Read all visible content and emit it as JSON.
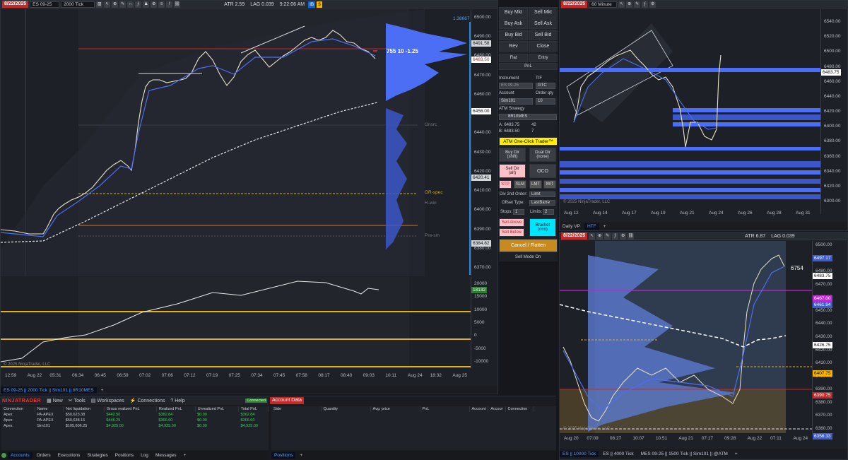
{
  "top_left": {
    "date": "8/22/2025",
    "instrument": "ES 09-25",
    "interval": "2000 Tick",
    "atr": "ATR 2.59",
    "lag": "LAG 0.039",
    "time": "9:22:06 AM",
    "badge1": "IB",
    "badge2": "$",
    "y_ticks": [
      "6500.00",
      "6490.00",
      "6480.00",
      "6470.00",
      "6460.00",
      "6450.00",
      "6440.00",
      "6430.00",
      "6420.00",
      "6410.00",
      "6400.00",
      "6390.00",
      "6380.00",
      "6370.00"
    ],
    "price_tags": [
      {
        "v": "6491.58",
        "bg": "#d3d6db",
        "fg": "#111"
      },
      {
        "v": "6483.50",
        "bg": "#ffffff",
        "fg": "#c62828"
      },
      {
        "v": "6456.00",
        "bg": "#ffffff",
        "fg": "#111"
      },
      {
        "v": "6420.41",
        "bg": "#d3d6db",
        "fg": "#111"
      },
      {
        "v": "6384.82",
        "bg": "#d3d6db",
        "fg": "#111"
      }
    ],
    "top_tag": "1.38667",
    "order_label": "755  10  -1.25",
    "level_labels": [
      "Onsrc",
      "OR-spec",
      "R-win",
      "Pre-sm"
    ],
    "ind_ticks": [
      "20000",
      "15000",
      "10000",
      "5000",
      "0",
      "-5000",
      "-10000"
    ],
    "ind_tag": "18132",
    "x_labels": [
      "12:59",
      "Aug 22",
      "05:31",
      "06:34",
      "06:45",
      "06:59",
      "07:02",
      "07:06",
      "07:12",
      "07:19",
      "07:25",
      "07:34",
      "07:45",
      "07:58",
      "08:17",
      "08:40",
      "09:03",
      "10:11",
      "Aug 24",
      "18:32",
      "Aug 25"
    ],
    "copyright": "© 2025 NinjaTrader, LLC",
    "bottom_tab": "ES 09-25 || 2000 Tick || Sim101 || 8R10MES"
  },
  "dom": {
    "buttons": [
      [
        "Buy Mkt",
        "Sell Mkt"
      ],
      [
        "Buy Ask",
        "Sell Ask"
      ],
      [
        "Buy Bid",
        "Sell Bid"
      ],
      [
        "Rev",
        "Close"
      ],
      [
        "Flat",
        "Entry"
      ]
    ],
    "pnl": "PnL",
    "instrument_label": "Instrument",
    "tif_label": "TIF",
    "instrument_value": "ES 09-25",
    "tif_value": "GTC",
    "account_label": "Account",
    "qty_label": "Order qty",
    "account_value": "Sim101",
    "qty_value": "10",
    "atm_label": "ATM Strategy",
    "atm_value": "8R10MES",
    "a_line": "A:  6483.75",
    "a_qty": "42",
    "b_line": "B:  6483.50",
    "b_qty": "7",
    "one_click": "ATM One-Click Trader™",
    "buy_dir": "Buy Dir\n(shift)",
    "dual_dir": "Dual Dir\n(none)",
    "sell_dir": "Sell Dir\n(alt)",
    "oco": "OCO",
    "ord_types": [
      "STP",
      "SLM",
      "LMT",
      "MIT"
    ],
    "div2": "Div 2nd Order:",
    "div2_value": "Limit",
    "offset": "Offset Type:",
    "offset_value": "LastBarre",
    "stops": "Stops:",
    "stops_value": "1",
    "limits": "Limits:",
    "limits_value": "2",
    "sell_above": "Sell Above",
    "sell_below": "Sell Below",
    "bracket": "Bracket\n(oco)",
    "cancel": "Cancel / Flatten",
    "sell_mode": "Sell Mode On"
  },
  "top_right": {
    "date": "8/22/2025",
    "interval": "60 Minute",
    "y_ticks": [
      "6540.00",
      "6520.00",
      "6500.00",
      "6480.00",
      "6460.00",
      "6440.00",
      "6420.00",
      "6400.00",
      "6380.00",
      "6360.00",
      "6340.00",
      "6320.00",
      "6300.00"
    ],
    "price_tag": "6483.75",
    "x_labels": [
      "Aug 12",
      "Aug 14",
      "Aug 17",
      "Aug 19",
      "Aug 21",
      "Aug 24",
      "Aug 26",
      "Aug 28",
      "Aug 31"
    ],
    "copyright": "© 2025 NinjaTrader, LLC",
    "tabs": [
      "Daily VP",
      "HTF"
    ]
  },
  "bottom_right": {
    "date": "8/22/2025",
    "atr": "ATR 6.87",
    "lag": "LAG 0.039",
    "y_ticks": [
      "6500.00",
      "6490.00",
      "6480.00",
      "6470.00",
      "6460.00",
      "6450.00",
      "6440.00",
      "6430.00",
      "6420.00",
      "6410.00",
      "6400.00",
      "6390.00",
      "6380.00",
      "6370.00",
      "6360.00"
    ],
    "price_tags": [
      {
        "v": "6497.17",
        "bg": "#3b5bdb",
        "fg": "#fff"
      },
      {
        "v": "6483.75",
        "bg": "#ffffff",
        "fg": "#111"
      },
      {
        "v": "6467.00",
        "bg": "#c026d3",
        "fg": "#fff"
      },
      {
        "v": "6461.94",
        "bg": "#3b5bdb",
        "fg": "#fff"
      },
      {
        "v": "6426.75",
        "bg": "#ffffff",
        "fg": "#111"
      },
      {
        "v": "6407.75",
        "bg": "#f5b400",
        "fg": "#111"
      },
      {
        "v": "6390.75",
        "bg": "#c62828",
        "fg": "#fff"
      },
      {
        "v": "6356.33",
        "bg": "#3b5bdb",
        "fg": "#fff"
      }
    ],
    "count": "6754",
    "x_labels": [
      "Aug 20",
      "07:09",
      "08:27",
      "10:07",
      "10:51",
      "Aug 21",
      "07:17",
      "09:28",
      "Aug 22",
      "07:11",
      "Aug 24"
    ],
    "copyright": "© 2025 NinjaTrader, LLC",
    "tabs": [
      "ES || 10000 Tick",
      "ES || 4000 Tick",
      "MES 09-25 || 1500 Tick || Sim101 || @ATM"
    ]
  },
  "control_center": {
    "brand": "NINJATRADER",
    "menu": [
      "New",
      "Tools",
      "Workspaces",
      "Connections",
      "Help"
    ],
    "connected": "Connected",
    "account_data_title": "Account Data",
    "acct_headers": [
      "Connection",
      "Name",
      "Net liquidation",
      "Gross realized PnL",
      "Realized PnL",
      "Unrealized PnL",
      "Total PnL"
    ],
    "acct_rows": [
      [
        "Apex",
        "PA-APEX",
        "$50,623.38",
        "$442.50",
        "$382.84",
        "$0.00",
        "$362.84"
      ],
      [
        "Apex",
        "PA-APEX",
        "$50,638.16",
        "$446.25",
        "$366.60",
        "$0.00",
        "$366.60"
      ],
      [
        "Apex",
        "Sim101",
        "$105,606.25",
        "$4,925.00",
        "$4,925.00",
        "$0.00",
        "$4,925.00"
      ]
    ],
    "pos_headers": [
      "Side",
      "Quantity",
      "Avg. price",
      "PnL",
      "Account",
      "Accour",
      "Connection"
    ],
    "bottom_tabs": [
      "Accounts",
      "Orders",
      "Executions",
      "Strategies",
      "Positions",
      "Log",
      "Messages"
    ],
    "positions_tab": "Positions"
  }
}
